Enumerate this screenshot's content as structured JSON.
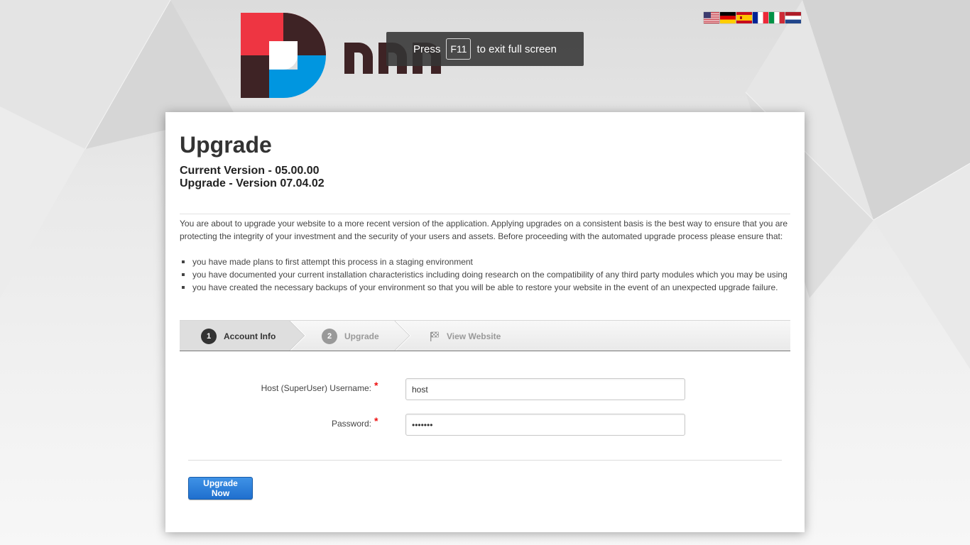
{
  "fullscreen_toast": {
    "press": "Press",
    "key": "F11",
    "rest": "to exit full screen"
  },
  "languages": [
    {
      "name": "us-flag-icon"
    },
    {
      "name": "germany-flag-icon"
    },
    {
      "name": "spain-flag-icon"
    },
    {
      "name": "france-flag-icon"
    },
    {
      "name": "italy-flag-icon"
    },
    {
      "name": "netherlands-flag-icon"
    }
  ],
  "header": {
    "title": "Upgrade",
    "current_version": "Current Version - 05.00.00",
    "upgrade_version": "Upgrade - Version 07.04.02"
  },
  "intro": {
    "text": "You are about to upgrade your website to a more recent version of the application. Applying upgrades on a consistent basis is the best way to ensure that you are protecting the integrity of your investment and the security of your users and assets. Before proceeding with the automated upgrade process please ensure that:",
    "bullets": [
      "you have made plans to first attempt this process in a staging environment",
      "you have documented your current installation characteristics including doing research on the compatibility of any third party modules which you may be using",
      "you have created the necessary backups of your environment so that you will be able to restore your website in the event of an unexpected upgrade failure."
    ]
  },
  "steps": [
    {
      "number": "1",
      "label": "Account Info",
      "active": true
    },
    {
      "number": "2",
      "label": "Upgrade",
      "active": false
    },
    {
      "number": "",
      "label": "View Website",
      "active": false
    }
  ],
  "form": {
    "username_label": "Host (SuperUser) Username:",
    "username_value": "host",
    "password_label": "Password:",
    "password_value": "1234567",
    "required_mark": "*"
  },
  "actions": {
    "upgrade_button": "Upgrade Now"
  },
  "colors": {
    "accent_blue": "#1f6fce",
    "logo_red": "#ee3542",
    "logo_blue": "#0096e0",
    "logo_dark": "#3e2325"
  }
}
